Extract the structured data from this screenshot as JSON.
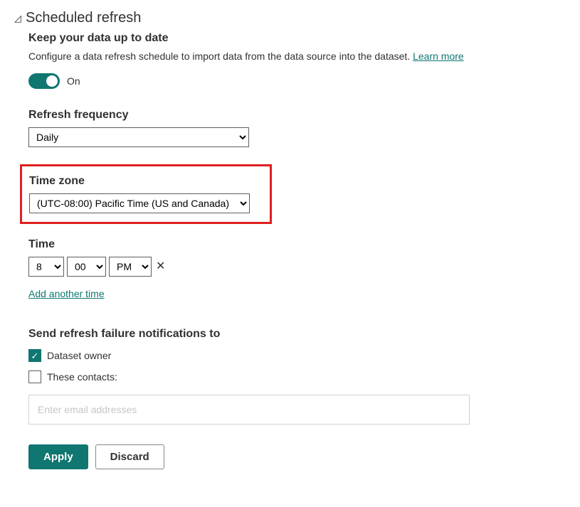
{
  "section": {
    "title": "Scheduled refresh",
    "subtitle": "Keep your data up to date",
    "description": "Configure a data refresh schedule to import data from the data source into the dataset. ",
    "learn_more": "Learn more"
  },
  "toggle": {
    "state_label": "On"
  },
  "frequency": {
    "label": "Refresh frequency",
    "value": "Daily"
  },
  "timezone": {
    "label": "Time zone",
    "value": "(UTC-08:00) Pacific Time (US and Canada)"
  },
  "time": {
    "label": "Time",
    "hour": "8",
    "minute": "00",
    "ampm": "PM",
    "add_label": "Add another time"
  },
  "notifications": {
    "label": "Send refresh failure notifications to",
    "dataset_owner": "Dataset owner",
    "these_contacts": "These contacts:",
    "placeholder": "Enter email addresses"
  },
  "buttons": {
    "apply": "Apply",
    "discard": "Discard"
  }
}
